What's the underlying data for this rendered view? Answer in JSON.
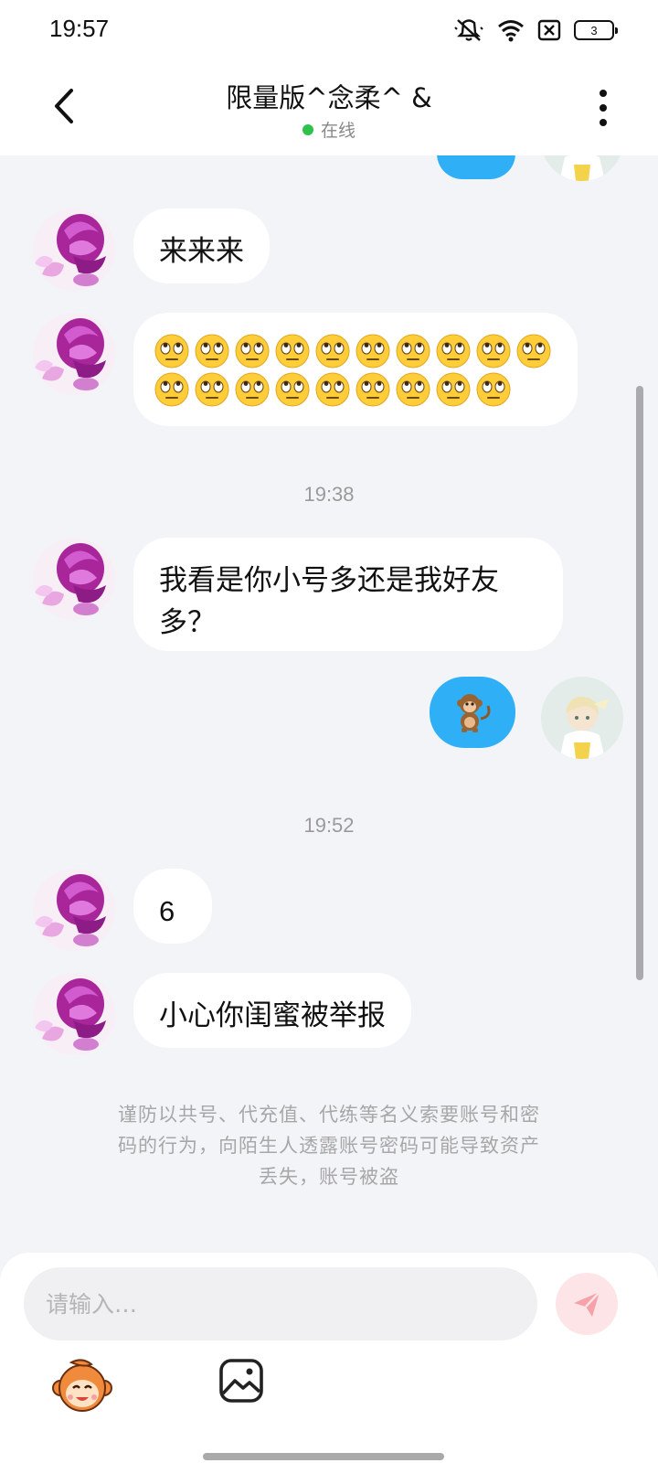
{
  "status_bar": {
    "time": "19:57",
    "battery": "3",
    "icons": [
      "mute-icon",
      "wifi-icon",
      "sim-off-icon",
      "battery-icon"
    ]
  },
  "header": {
    "title": "限量版^念柔^ &",
    "status": "在线",
    "status_color": "#2ec14b"
  },
  "messages": [
    {
      "side": "right",
      "type": "partial",
      "note": ""
    },
    {
      "side": "left",
      "type": "text",
      "text": "来来来"
    },
    {
      "side": "left",
      "type": "emoji",
      "emoji": "🙄",
      "count": 19
    },
    {
      "side": "center",
      "type": "timestamp",
      "text": "19:38"
    },
    {
      "side": "left",
      "type": "text",
      "line1": "我看是你小号多还是我好友",
      "line2": "多？"
    },
    {
      "side": "right",
      "type": "emoji",
      "emoji": "🐒"
    },
    {
      "side": "center",
      "type": "timestamp",
      "text": "19:52"
    },
    {
      "side": "left",
      "type": "text",
      "text": "6"
    },
    {
      "side": "left",
      "type": "text",
      "text": "小心你闺蜜被举报"
    }
  ],
  "notice": {
    "line1": "谨防以共号、代充值、代练等名义索要账号和密",
    "line2": "码的行为，向陌生人透露账号密码可能导致资产",
    "line3": "丢失，账号被盗"
  },
  "input": {
    "placeholder": "请输入…",
    "value": ""
  },
  "colors": {
    "accent_blue": "#2fb0f6",
    "background": "#f2f4f8",
    "send_button_bg": "#fde4e6",
    "send_icon": "#f7a1a8"
  }
}
